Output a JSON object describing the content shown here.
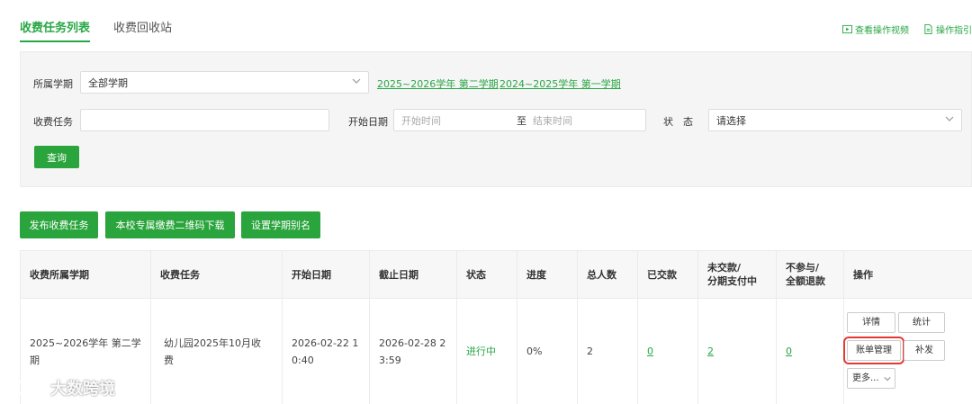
{
  "tabs": [
    {
      "label": "收费任务列表",
      "active": true
    },
    {
      "label": "收费回收站",
      "active": false
    }
  ],
  "top_links": {
    "video": {
      "label": "查看操作视频",
      "icon": "video-icon"
    },
    "guide": {
      "label": "操作指引",
      "icon": "document-icon"
    }
  },
  "filter": {
    "term_label": "所属学期",
    "term_value": "全部学期",
    "term_links": [
      "2025~2026学年 第二学期",
      "2024~2025学年 第一学期"
    ],
    "task_label": "收费任务",
    "task_value": "",
    "date_label": "开始日期",
    "date_start_placeholder": "开始时间",
    "date_sep": "至",
    "date_end_placeholder": "结束时间",
    "status_label": "状　态",
    "status_value": "请选择",
    "query_button": "查询"
  },
  "actions": {
    "publish": "发布收费任务",
    "qrcode": "本校专属缴费二维码下载",
    "alias": "设置学期别名"
  },
  "table": {
    "headers": [
      "收费所属学期",
      "收费任务",
      "开始日期",
      "截止日期",
      "状态",
      "进度",
      "总人数",
      "已交款",
      "未交款/\n分期支付中",
      "不参与/\n全额退款",
      "操作"
    ],
    "rows": [
      {
        "term": "2025~2026学年 第二学期",
        "task": "幼儿园2025年10月收费",
        "start": "2026-02-22 10:40",
        "end": "2026-02-28 23:59",
        "status": "进行中",
        "progress": "0%",
        "total": "2",
        "paid": "0",
        "unpaid": "2",
        "excluded": "0",
        "ops": {
          "detail": "详情",
          "stats": "统计",
          "bill": "账单管理",
          "supplement": "补发",
          "more": "更多..."
        }
      }
    ]
  },
  "watermark": {
    "text": "大数跨境"
  },
  "colors": {
    "accent": "#28a745",
    "button": "#2aa43c",
    "highlight": "#e53935"
  }
}
